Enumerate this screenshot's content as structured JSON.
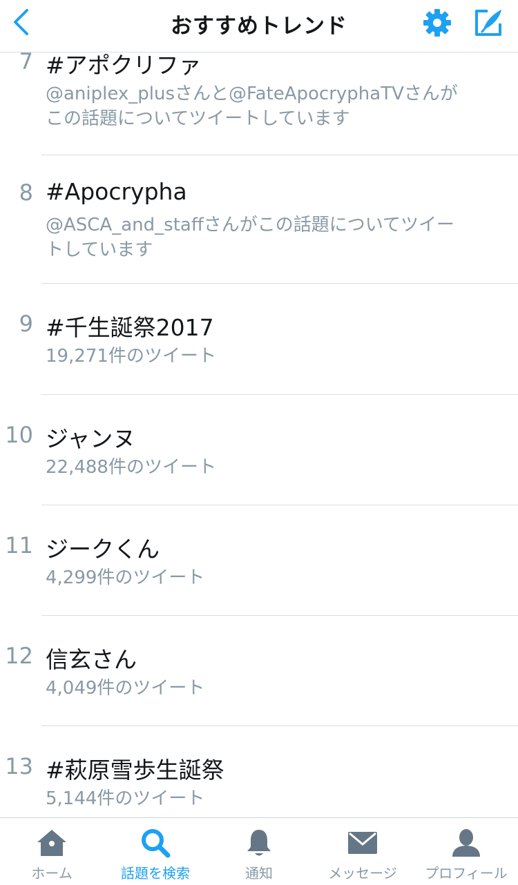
{
  "header": {
    "title": "おすすめトレンド"
  },
  "trends": [
    {
      "rank": "7",
      "name": "#アポクリファ",
      "desc_lines": [
        "@aniplex_plusさんと@FateApocryphaTVさんが",
        "この話題についてツイートしています"
      ]
    },
    {
      "rank": "8",
      "name": "#Apocrypha",
      "desc_lines": [
        "@ASCA_and_staffさんがこの話題についてツイー",
        "トしています"
      ]
    },
    {
      "rank": "9",
      "name": "#千生誕祭2017",
      "desc_lines": [
        "19,271件のツイート"
      ]
    },
    {
      "rank": "10",
      "name": "ジャンヌ",
      "desc_lines": [
        "22,488件のツイート"
      ]
    },
    {
      "rank": "11",
      "name": "ジークくん",
      "desc_lines": [
        "4,299件のツイート"
      ]
    },
    {
      "rank": "12",
      "name": "信玄さん",
      "desc_lines": [
        "4,049件のツイート"
      ]
    },
    {
      "rank": "13",
      "name": "#萩原雪歩生誕祭",
      "desc_lines": [
        "5,144件のツイート"
      ]
    }
  ],
  "tabs": [
    {
      "label": "ホーム",
      "icon": "home-icon"
    },
    {
      "label": "話題を検索",
      "icon": "search-icon"
    },
    {
      "label": "通知",
      "icon": "bell-icon"
    },
    {
      "label": "メッセージ",
      "icon": "envelope-icon"
    },
    {
      "label": "プロフィール",
      "icon": "person-icon"
    }
  ],
  "colors": {
    "accent": "#1da1f2",
    "text": "#14171a",
    "muted": "#8899a6",
    "tab_inactive": "#657786"
  }
}
